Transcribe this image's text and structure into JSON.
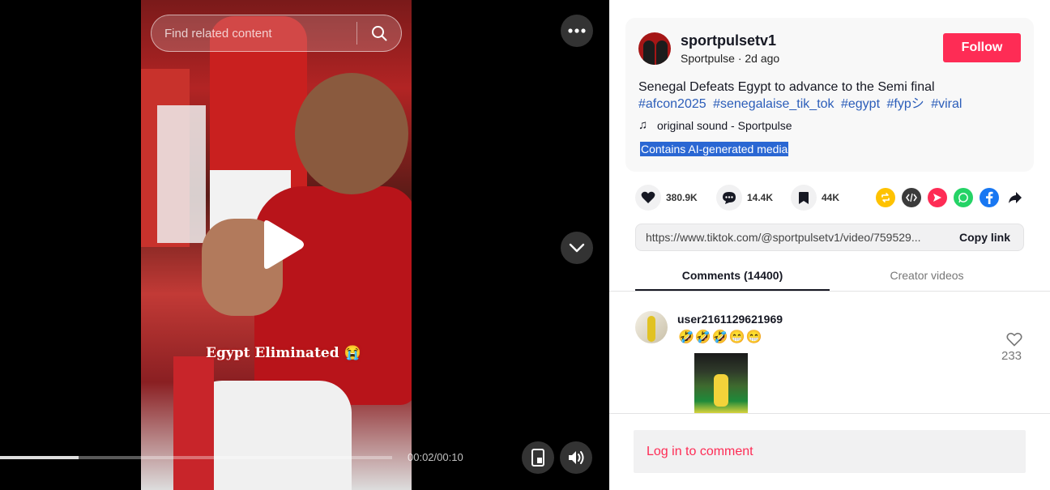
{
  "video": {
    "search_placeholder": "Find related content",
    "caption": "Egypt Eliminated 😭",
    "time": "00:02/00:10",
    "progress_fraction": 0.2
  },
  "post": {
    "username": "sportpulsetv1",
    "display_name": "Sportpulse",
    "age": "2d ago",
    "follow_label": "Follow",
    "description": "Senegal Defeats Egypt to advance to the Semi final",
    "hashtags": [
      "#afcon2025",
      "#senegalaise_tik_tok",
      "#egypt",
      "#fypシ",
      "#viral"
    ],
    "sound": "original sound - Sportpulse",
    "ai_label": "Contains AI-generated media"
  },
  "stats": {
    "likes": "380.9K",
    "comments": "14.4K",
    "saves": "44K"
  },
  "share": {
    "url": "https://www.tiktok.com/@sportpulsetv1/video/759529...",
    "copy_label": "Copy link"
  },
  "tabs": {
    "comments": "Comments (14400)",
    "creator": "Creator videos"
  },
  "comment": {
    "user": "user2161129621969",
    "text": "🤣🤣🤣😁😁",
    "likes": "233"
  },
  "login": {
    "label": "Log in to comment"
  },
  "colors": {
    "accent": "#fe2c55",
    "hashtag": "#2b5db9",
    "ai_highlight": "#2a67d3"
  }
}
